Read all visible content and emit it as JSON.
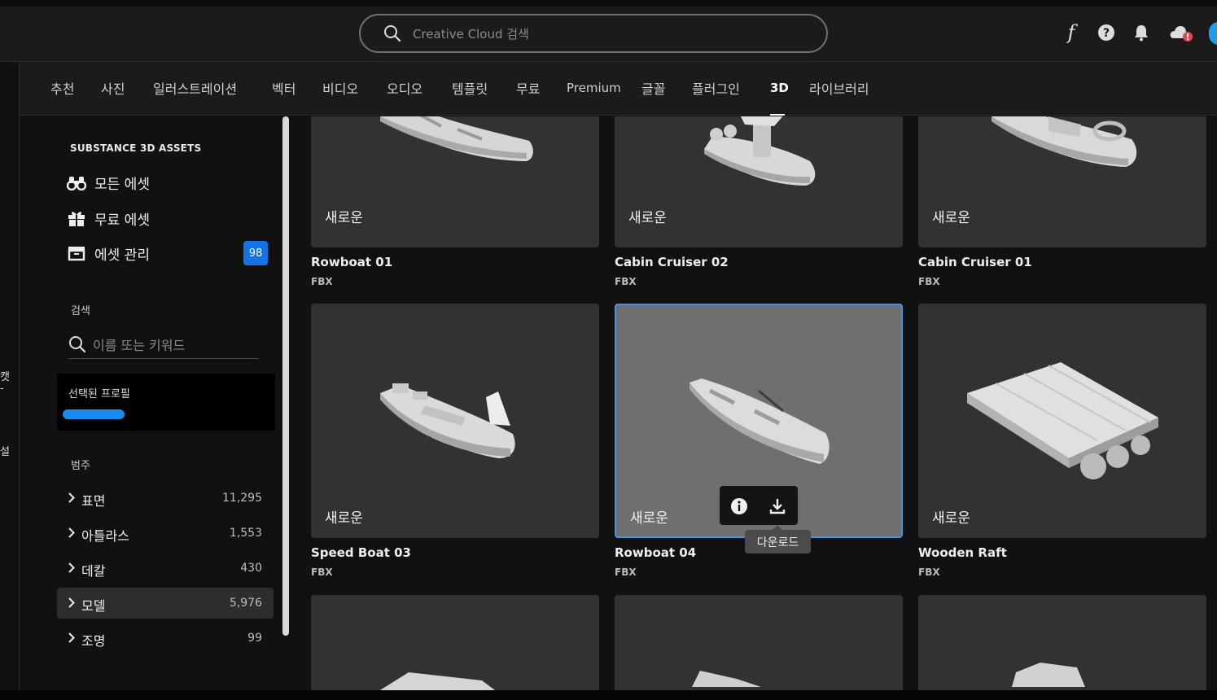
{
  "topbar": {
    "search_placeholder": "Creative Cloud 검색",
    "icons": [
      "search-icon",
      "font-icon",
      "help-icon",
      "bell-icon",
      "cloud-alert-icon",
      "avatar"
    ]
  },
  "leftstrip": {
    "text1": "캣",
    "text2": "-",
    "text3": "설"
  },
  "nav": {
    "items": [
      "추천",
      "사진",
      "일러스트레이션",
      "벡터",
      "비디오",
      "오디오",
      "템플릿",
      "무료",
      "Premium",
      "글꼴",
      "플러그인",
      "3D",
      "라이브러리"
    ],
    "active": "3D"
  },
  "sidebar": {
    "section_title": "SUBSTANCE 3D ASSETS",
    "links": [
      "모든 에셋",
      "무료 에셋",
      "에셋 관리"
    ],
    "manage_badge": "98",
    "search_label": "검색",
    "search_placeholder": "이름 또는 키워드",
    "profile_label": "선택된 프로필",
    "category_label": "범주",
    "categories": [
      {
        "name": "표면",
        "count": "11,295"
      },
      {
        "name": "아틀라스",
        "count": "1,553"
      },
      {
        "name": "데칼",
        "count": "430"
      },
      {
        "name": "모델",
        "count": "5,976"
      },
      {
        "name": "조명",
        "count": "99"
      }
    ],
    "active_category": "모델"
  },
  "grid": {
    "new_label": "새로운",
    "cards": [
      {
        "title": "Rowboat 01",
        "format": "FBX"
      },
      {
        "title": "Cabin Cruiser 02",
        "format": "FBX"
      },
      {
        "title": "Cabin Cruiser 01",
        "format": "FBX"
      },
      {
        "title": "Speed Boat 03",
        "format": "FBX"
      },
      {
        "title": "Rowboat 04",
        "format": "FBX"
      },
      {
        "title": "Wooden Raft",
        "format": "FBX"
      }
    ],
    "tooltip": "다운로드",
    "accent": "#4a90e2"
  },
  "colors": {
    "badge": "#1473e6",
    "avatar": "#1aa1ee"
  }
}
